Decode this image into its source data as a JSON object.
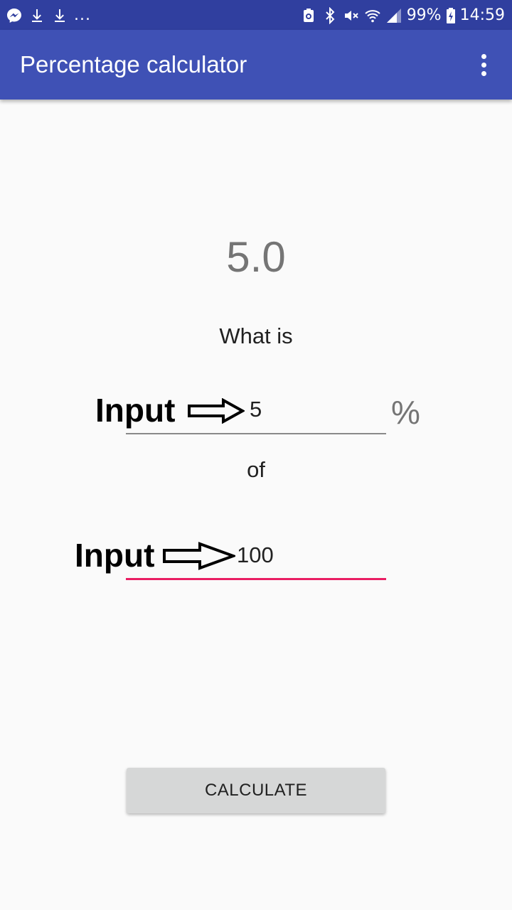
{
  "status_bar": {
    "left_icons": [
      "messenger-icon",
      "download-icon",
      "download-icon"
    ],
    "overflow_dots": "...",
    "right_icons": [
      "cleaner-icon",
      "bluetooth-icon",
      "mute-icon",
      "wifi-icon",
      "signal-icon"
    ],
    "battery": "99%",
    "time": "14:59",
    "background_color": "#303f9f"
  },
  "app_bar": {
    "title": "Percentage calculator",
    "menu_icon": "more-vert-icon",
    "background_color": "#3f51b5"
  },
  "main": {
    "result": "5.0",
    "what_is_label": "What is",
    "percent_input": {
      "value": "5",
      "placeholder": ""
    },
    "percent_sign": "%",
    "of_label": "of",
    "total_input": {
      "value": "100",
      "placeholder": ""
    },
    "calculate_button": "CALCULATE",
    "accent_color": "#e91e63"
  },
  "annotations": {
    "first": "Input",
    "second": "Input",
    "arrow_icon": "arrow-right-outline-icon"
  }
}
